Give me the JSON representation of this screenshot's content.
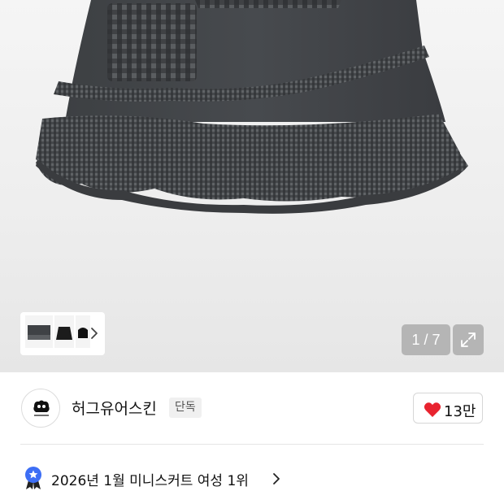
{
  "gallery": {
    "image_subject": "plaid ruffle mini skirt",
    "counter": "1 / 7",
    "thumbnails": [
      "thumbnail-1",
      "thumbnail-2",
      "thumbnail-3"
    ],
    "next_icon": "chevron-right-icon",
    "expand_icon": "expand-icon"
  },
  "brand": {
    "name": "허그유어스킨",
    "badge": "단독",
    "logo_icon": "brand-logo-icon",
    "like_count": "13만",
    "like_icon": "heart-icon",
    "like_color": "#e8232f"
  },
  "ranking": {
    "text": "2026년 1월 미니스커트 여성 1위",
    "icon": "rank-medal-icon",
    "chevron_icon": "chevron-right-icon",
    "medal_color": "#3d6ef5"
  }
}
